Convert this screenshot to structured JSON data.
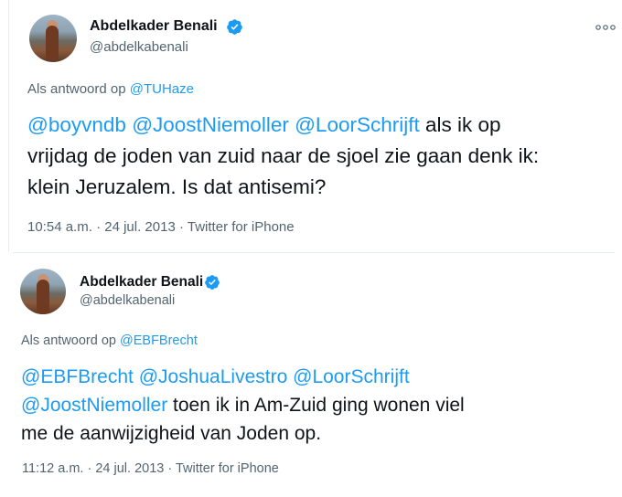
{
  "tweets": [
    {
      "author_name": "Abdelkader Benali",
      "author_handle": "@abdelkabenali",
      "reply_prefix": "Als antwoord op",
      "reply_to": "@TUHaze",
      "text_lines": [
        [
          {
            "t": "@boyvndb",
            "link": true
          },
          {
            "t": " ",
            "link": false
          },
          {
            "t": "@JoostNiemoller",
            "link": true
          },
          {
            "t": " ",
            "link": false
          },
          {
            "t": "@LoorSchrijft",
            "link": true
          },
          {
            "t": " als ik op",
            "link": false
          }
        ],
        [
          {
            "t": "vrijdag de joden van zuid naar de sjoel zie gaan denk ik:",
            "link": false
          }
        ],
        [
          {
            "t": "klein Jeruzalem. Is dat antisemi?",
            "link": false
          }
        ]
      ],
      "time": "10:54 a.m.",
      "date": "24 jul. 2013",
      "source": "Twitter for iPhone",
      "separator": "·"
    },
    {
      "author_name": "Abdelkader Benali",
      "author_handle": "@abdelkabenali",
      "reply_prefix": "Als antwoord op",
      "reply_to": "@EBFBrecht",
      "text_lines": [
        [
          {
            "t": "@EBFBrecht",
            "link": true
          },
          {
            "t": " ",
            "link": false
          },
          {
            "t": "@JoshuaLivestro",
            "link": true
          },
          {
            "t": " ",
            "link": false
          },
          {
            "t": "@LoorSchrijft",
            "link": true
          }
        ],
        [
          {
            "t": "@JoostNiemoller",
            "link": true
          },
          {
            "t": " toen ik in Am-Zuid ging wonen viel",
            "link": false
          }
        ],
        [
          {
            "t": "me de aanwijzigheid van Joden op.",
            "link": false
          }
        ]
      ],
      "time": "11:12 a.m.",
      "date": "24 jul. 2013",
      "source": "Twitter for iPhone",
      "separator": "·"
    }
  ],
  "icons": {
    "verified": "verified-badge-icon",
    "more": "more-options-icon"
  },
  "colors": {
    "link": "#1d9bf0",
    "verified": "#1d9bf0",
    "secondary_text": "#536471",
    "primary_text": "#0f1419"
  }
}
